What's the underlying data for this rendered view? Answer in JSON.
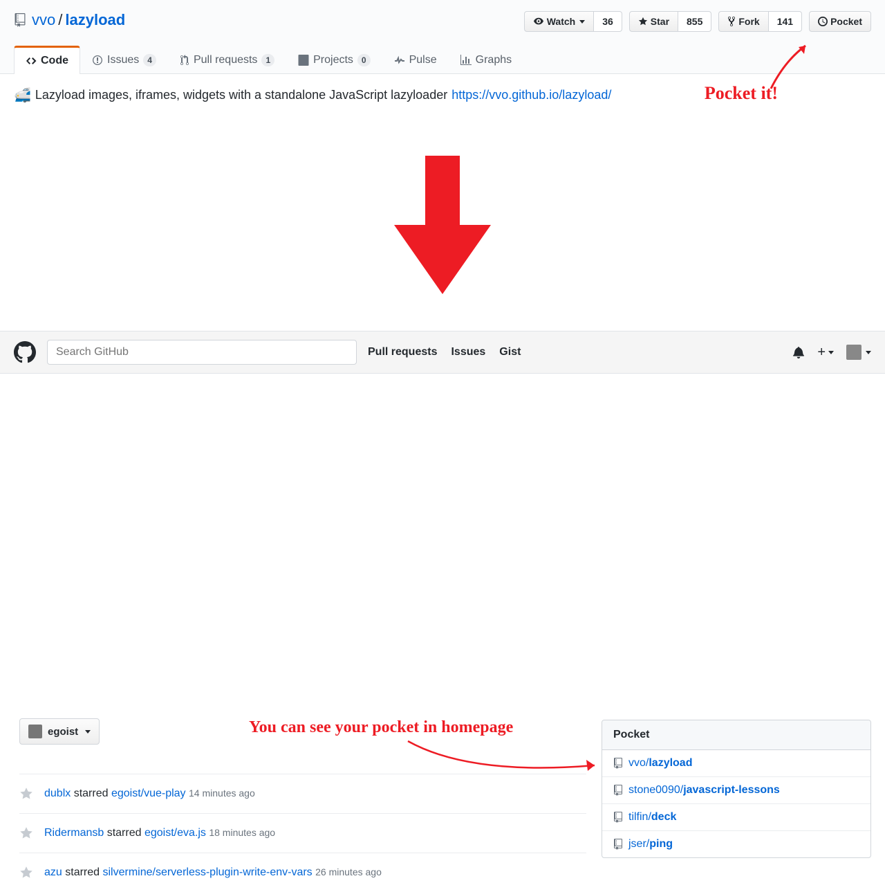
{
  "repo": {
    "owner": "vvo",
    "name": "lazyload",
    "description": "Lazyload images, iframes, widgets with a standalone JavaScript lazyloader",
    "url": "https://vvo.github.io/lazyload/",
    "emoji": "🚅"
  },
  "actions": {
    "watch": {
      "label": "Watch",
      "count": "36"
    },
    "star": {
      "label": "Star",
      "count": "855"
    },
    "fork": {
      "label": "Fork",
      "count": "141"
    },
    "pocket": {
      "label": "Pocket"
    }
  },
  "tabs": {
    "code": "Code",
    "issues": {
      "label": "Issues",
      "count": "4"
    },
    "pulls": {
      "label": "Pull requests",
      "count": "1"
    },
    "projects": {
      "label": "Projects",
      "count": "0"
    },
    "pulse": "Pulse",
    "graphs": "Graphs"
  },
  "annotations": {
    "a1": "Pocket it!",
    "a2": "You can see your pocket in homepage"
  },
  "search": {
    "placeholder": "Search GitHub"
  },
  "headerNav": {
    "pulls": "Pull requests",
    "issues": "Issues",
    "gist": "Gist"
  },
  "userSelect": "egoist",
  "feed": [
    {
      "actor": "dublx",
      "verb": "starred",
      "repo": "egoist/vue-play",
      "time": "14 minutes ago"
    },
    {
      "actor": "Ridermansb",
      "verb": "starred",
      "repo": "egoist/eva.js",
      "time": "18 minutes ago"
    },
    {
      "actor": "azu",
      "verb": "starred",
      "repo": "silvermine/serverless-plugin-write-env-vars",
      "time": "26 minutes ago"
    }
  ],
  "pocket": {
    "title": "Pocket",
    "items": [
      {
        "owner": "vvo",
        "name": "lazyload"
      },
      {
        "owner": "stone0090",
        "name": "javascript-lessons"
      },
      {
        "owner": "tilfin",
        "name": "deck"
      },
      {
        "owner": "jser",
        "name": "ping"
      }
    ]
  }
}
